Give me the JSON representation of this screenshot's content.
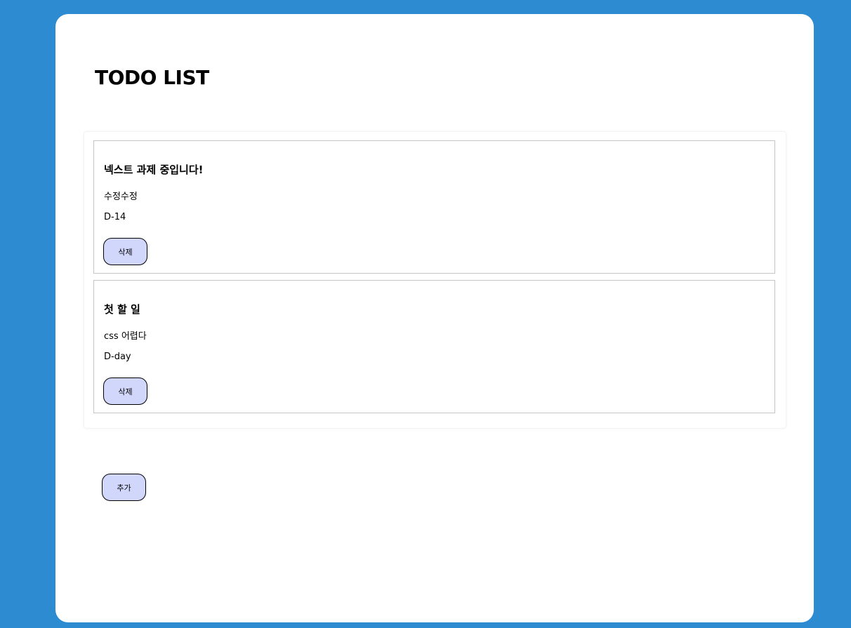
{
  "app": {
    "title": "TODO LIST"
  },
  "todos": [
    {
      "title": "넥스트 과제 중입니다!",
      "body": "수정수정",
      "due": "D-14",
      "delete_label": "삭제"
    },
    {
      "title": "첫 할 일",
      "body": "css 어렵다",
      "due": "D-day",
      "delete_label": "삭제"
    }
  ],
  "actions": {
    "add_label": "추가"
  },
  "colors": {
    "background": "#2d8bd1",
    "card": "#ffffff",
    "button": "#d1d6fb",
    "item_border": "#c4c4c4"
  }
}
